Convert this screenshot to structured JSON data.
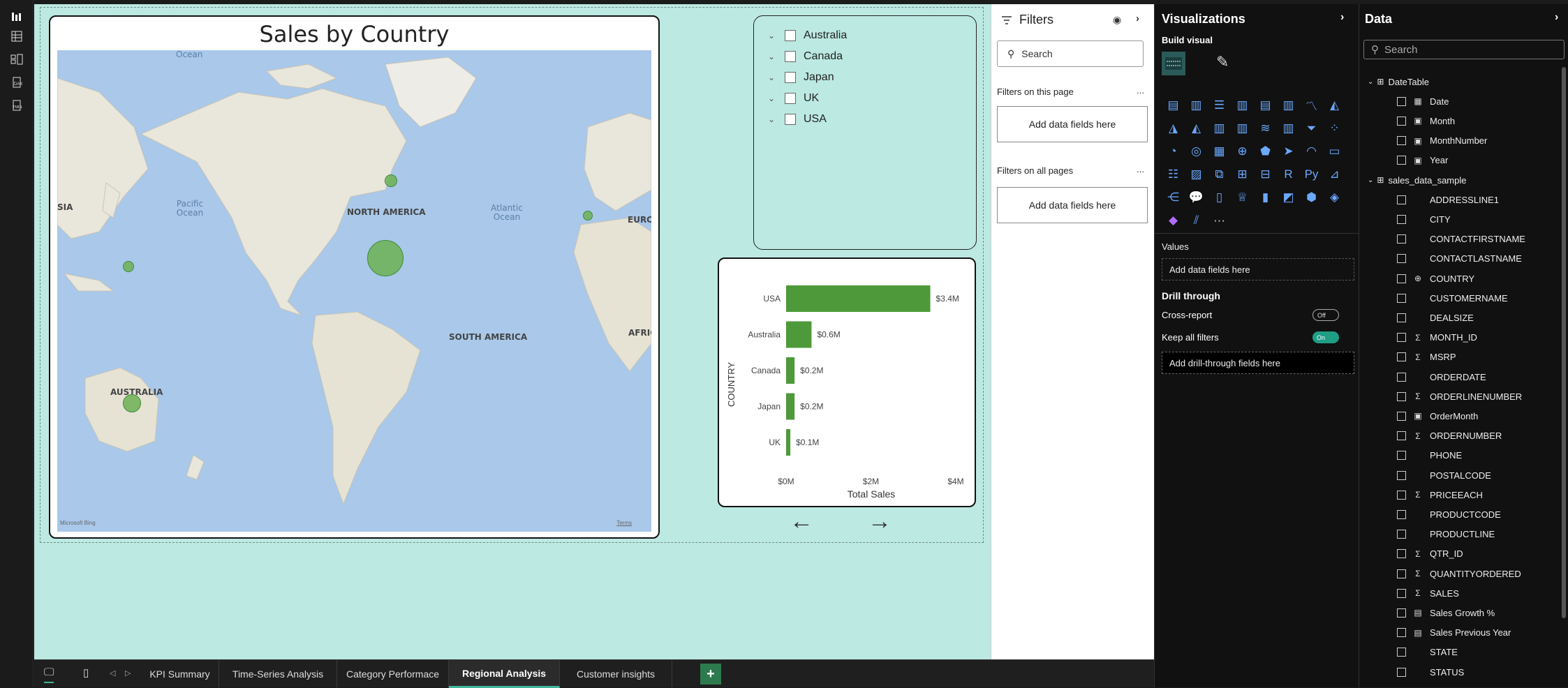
{
  "rail": {
    "icons": [
      "report-view-icon",
      "table-view-icon",
      "model-view-icon",
      "dax-query-icon",
      "tmdl-icon"
    ]
  },
  "map_visual": {
    "title": "Sales by Country",
    "continent_labels": [
      "NORTH AMERICA",
      "SOUTH AMERICA",
      "AUSTRALIA",
      "EUROI",
      "AFRIC",
      "SIA"
    ],
    "ocean_labels": {
      "pacific": "Pacific Ocean",
      "atlantic": "Atlantic Ocean",
      "top": "Ocean"
    },
    "attribution": "Microsoft Bing",
    "terms": "Terms"
  },
  "slicer": {
    "items": [
      "Australia",
      "Canada",
      "Japan",
      "UK",
      "USA"
    ]
  },
  "chart_data": {
    "type": "bar",
    "orientation": "horizontal",
    "categories": [
      "USA",
      "Australia",
      "Canada",
      "Japan",
      "UK"
    ],
    "values": [
      3.4,
      0.6,
      0.2,
      0.2,
      0.1
    ],
    "data_labels": [
      "$3.4M",
      "$0.6M",
      "$0.2M",
      "$0.2M",
      "$0.1M"
    ],
    "xlabel": "Total Sales",
    "ylabel": "COUNTRY",
    "xlim": [
      0,
      4
    ],
    "xticks": [
      "$0M",
      "$2M",
      "$4M"
    ],
    "color": "#4e9a3a"
  },
  "filters": {
    "title": "Filters",
    "search_placeholder": "Search",
    "on_page": "Filters on this page",
    "on_all": "Filters on all pages",
    "add_fields": "Add data fields here",
    "more": "..."
  },
  "viz": {
    "title": "Visualizations",
    "build_visual": "Build visual",
    "values_label": "Values",
    "values_add": "Add data fields here",
    "drill_through": "Drill through",
    "cross_report": "Cross-report",
    "cross_report_state": "Off",
    "keep_filters": "Keep all filters",
    "keep_filters_state": "On",
    "drill_add": "Add drill-through fields here"
  },
  "data_pane": {
    "title": "Data",
    "search_placeholder": "Search",
    "tables": [
      {
        "name": "DateTable",
        "fields": [
          {
            "name": "Date",
            "icon": "calendar"
          },
          {
            "name": "Month",
            "icon": "calc"
          },
          {
            "name": "MonthNumber",
            "icon": "calc"
          },
          {
            "name": "Year",
            "icon": "calc"
          }
        ]
      },
      {
        "name": "sales_data_sample",
        "fields": [
          {
            "name": "ADDRESSLINE1",
            "icon": ""
          },
          {
            "name": "CITY",
            "icon": ""
          },
          {
            "name": "CONTACTFIRSTNAME",
            "icon": ""
          },
          {
            "name": "CONTACTLASTNAME",
            "icon": ""
          },
          {
            "name": "COUNTRY",
            "icon": "globe"
          },
          {
            "name": "CUSTOMERNAME",
            "icon": ""
          },
          {
            "name": "DEALSIZE",
            "icon": ""
          },
          {
            "name": "MONTH_ID",
            "icon": "sigma"
          },
          {
            "name": "MSRP",
            "icon": "sigma"
          },
          {
            "name": "ORDERDATE",
            "icon": ""
          },
          {
            "name": "ORDERLINENUMBER",
            "icon": "sigma"
          },
          {
            "name": "OrderMonth",
            "icon": "calc"
          },
          {
            "name": "ORDERNUMBER",
            "icon": "sigma"
          },
          {
            "name": "PHONE",
            "icon": ""
          },
          {
            "name": "POSTALCODE",
            "icon": ""
          },
          {
            "name": "PRICEEACH",
            "icon": "sigma"
          },
          {
            "name": "PRODUCTCODE",
            "icon": ""
          },
          {
            "name": "PRODUCTLINE",
            "icon": ""
          },
          {
            "name": "QTR_ID",
            "icon": "sigma"
          },
          {
            "name": "QUANTITYORDERED",
            "icon": "sigma"
          },
          {
            "name": "SALES",
            "icon": "sigma"
          },
          {
            "name": "Sales Growth %",
            "icon": "measure"
          },
          {
            "name": "Sales Previous Year",
            "icon": "measure"
          },
          {
            "name": "STATE",
            "icon": ""
          },
          {
            "name": "STATUS",
            "icon": ""
          }
        ]
      }
    ]
  },
  "tabs": {
    "items": [
      "KPI Summary",
      "Time-Series Analysis",
      "Category Performace",
      "Regional Analysis",
      "Customer insights"
    ],
    "active": "Regional Analysis",
    "add": "+"
  },
  "colors": {
    "canvas": "#bce9e1",
    "accent": "#3fb89a",
    "bar": "#4e9a3a"
  }
}
